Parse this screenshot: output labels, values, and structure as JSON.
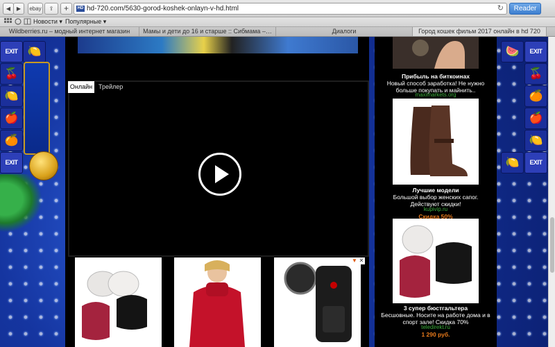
{
  "toolbar": {
    "back_label": "◀",
    "forward_label": "▶",
    "ebay_label": "ebay",
    "share_label": "⇪",
    "add_label": "+",
    "url": "hd-720.com/5630-gorod-koshek-onlayn-v-hd.html",
    "favicon_label": "HD",
    "reload_label": "↻",
    "reader_label": "Reader"
  },
  "bookmarks": [
    {
      "label": "Новости ▾"
    },
    {
      "label": "Популярные ▾"
    }
  ],
  "tabs": [
    {
      "label": "Wildberries.ru – модный интернет магазин"
    },
    {
      "label": "Мамы и дети до 16 и старше :: Сибмама –…"
    },
    {
      "label": "Диалоги"
    },
    {
      "label": "Город кошек фильм 2017 онлайн в hd 720"
    }
  ],
  "player": {
    "tab_online": "Онлайн",
    "tab_trailer": "Трейлер"
  },
  "slot": {
    "exit_label": "EXIT"
  },
  "right_ads": [
    {
      "title": "Прибыль на биткоинах",
      "desc": "Новый способ заработка! Не нужно больше покупать и майнить..",
      "domain": "maximarkets.org",
      "promo": ""
    },
    {
      "title": "Лучшие модели",
      "desc": "Большой выбор женских сапог. Действуют скидки!",
      "domain": "kupivip.ru",
      "promo": "Скидка 50%"
    },
    {
      "title": "3 супер бюстгальтера",
      "desc": "Бесшовные. Носите на работе дома и в спорт зале! Скидка 70%",
      "domain": "teledirekt.ru",
      "promo": "1 290 руб."
    }
  ],
  "colors": {
    "accent_blue": "#3d7fd0",
    "domain_green": "#3cae3c",
    "promo_orange": "#e87a1b",
    "page_bg": "#1a3fb0"
  }
}
